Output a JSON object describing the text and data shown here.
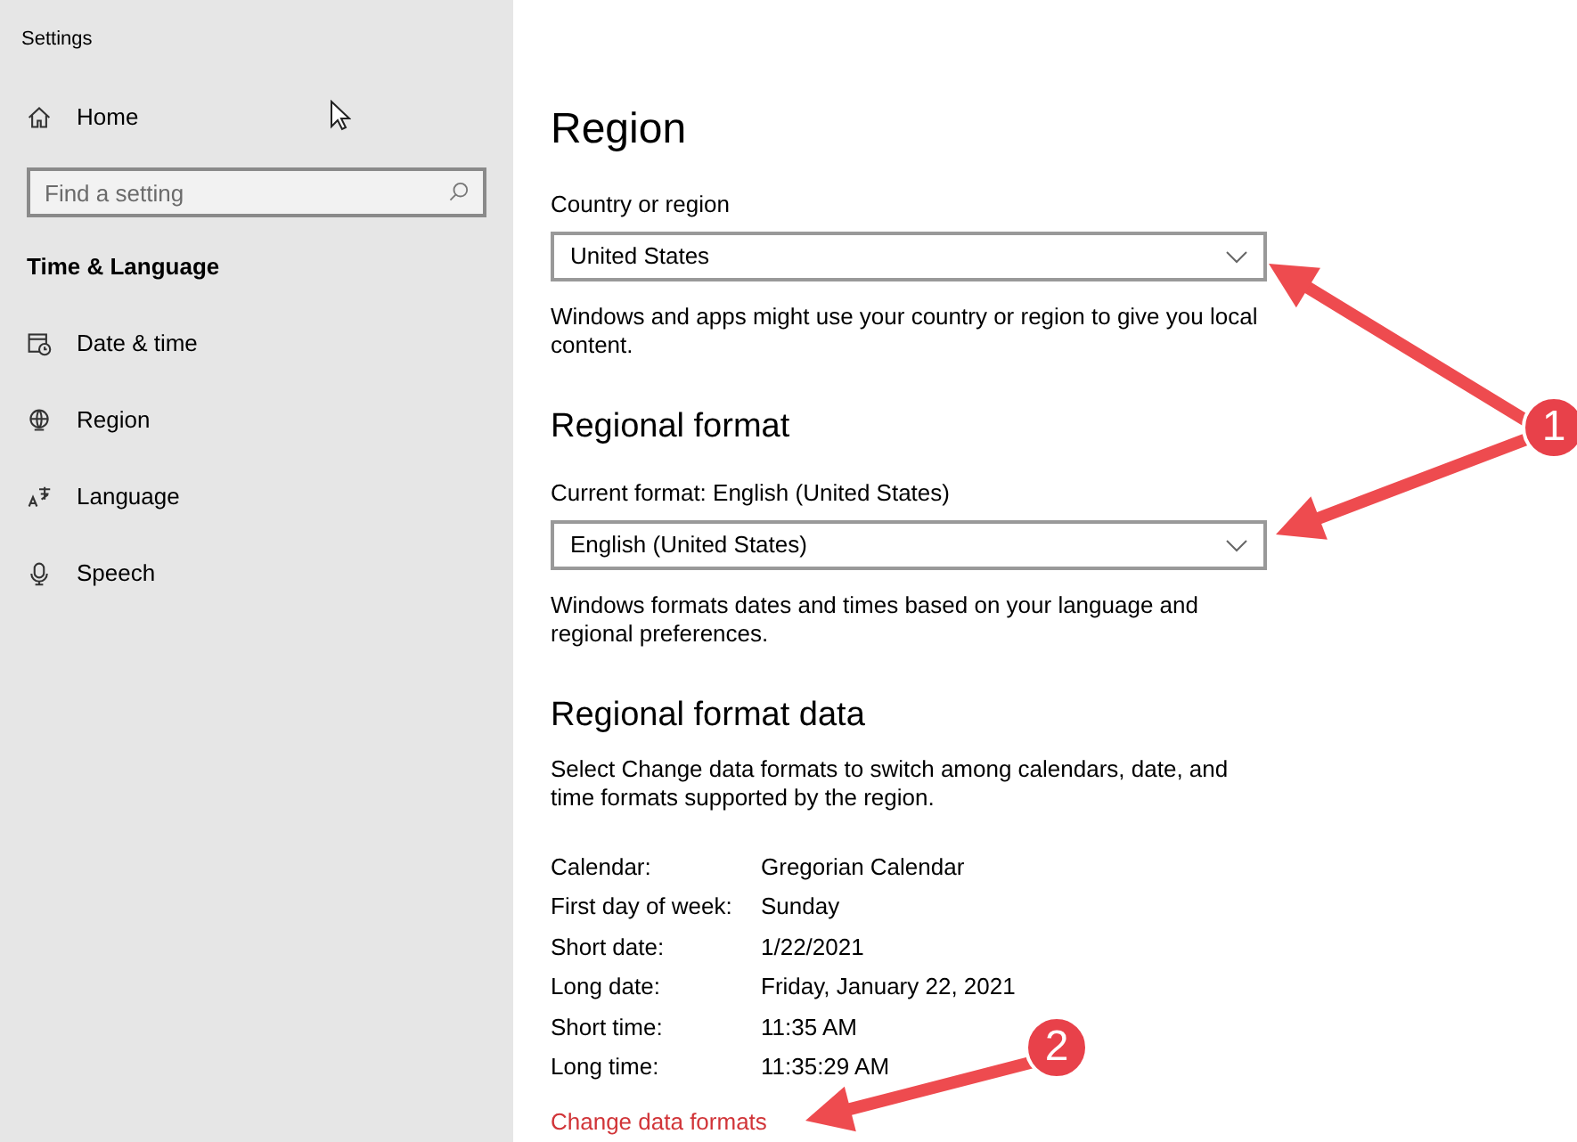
{
  "window": {
    "title": "Settings"
  },
  "sidebar": {
    "home": "Home",
    "search": {
      "placeholder": "Find a setting"
    },
    "section": "Time & Language",
    "items": [
      {
        "label": "Date & time",
        "kind": "calendar"
      },
      {
        "label": "Region",
        "kind": "globe"
      },
      {
        "label": "Language",
        "kind": "language"
      },
      {
        "label": "Speech",
        "kind": "microphone"
      }
    ]
  },
  "page": {
    "title": "Region",
    "country": {
      "label": "Country or region",
      "value": "United States",
      "description": "Windows and apps might use your country or region to give you local content."
    },
    "regional_format": {
      "heading": "Regional format",
      "label": "Current format: English (United States)",
      "value": "English (United States)",
      "description": "Windows formats dates and times based on your language and regional preferences."
    },
    "format_data": {
      "heading": "Regional format data",
      "description": "Select Change data formats to switch among calendars, date, and time formats supported by the region.",
      "rows": [
        {
          "label": "Calendar:",
          "value": "Gregorian Calendar"
        },
        {
          "label": "First day of week:",
          "value": "Sunday"
        },
        {
          "label": "Short date:",
          "value": "1/22/2021"
        },
        {
          "label": "Long date:",
          "value": "Friday, January 22, 2021"
        },
        {
          "label": "Short time:",
          "value": "11:35 AM"
        },
        {
          "label": "Long time:",
          "value": "11:35:29 AM"
        }
      ],
      "link": "Change data formats"
    }
  },
  "annotations": [
    {
      "badge": "1"
    },
    {
      "badge": "2"
    }
  ]
}
